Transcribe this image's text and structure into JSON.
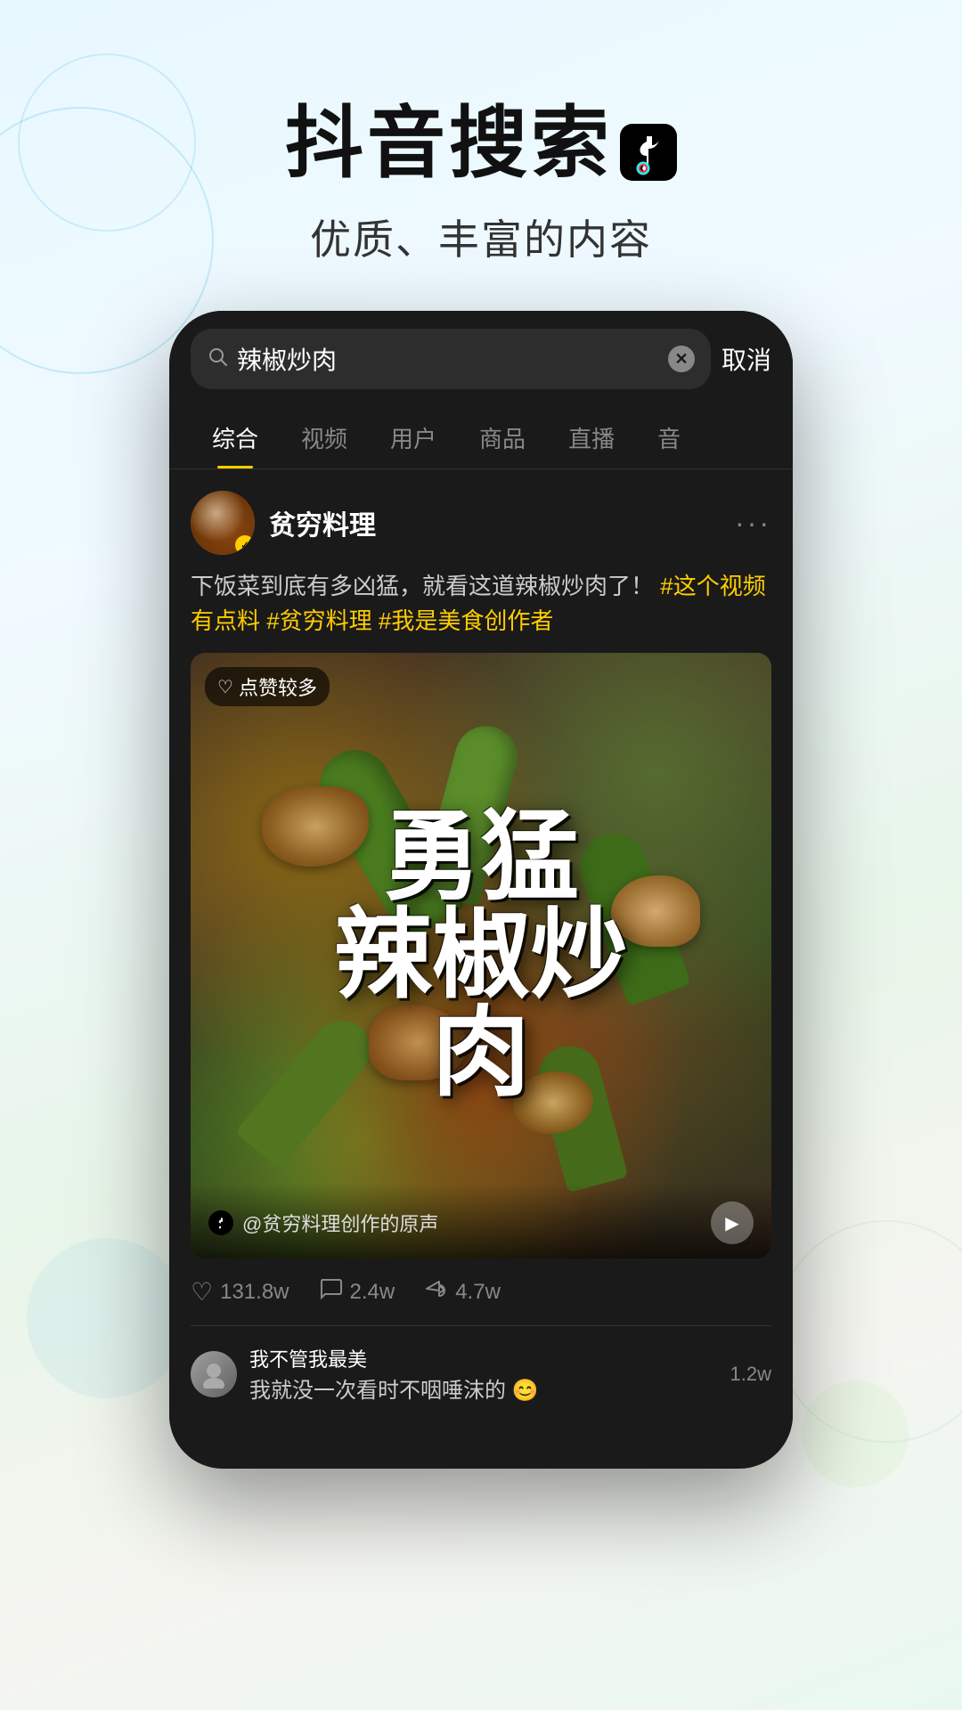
{
  "background": {
    "gradient_start": "#e8f8ff",
    "gradient_end": "#e8f8f0"
  },
  "header": {
    "title": "抖音搜索",
    "subtitle": "优质、丰富的内容",
    "logo_alt": "TikTok logo"
  },
  "phone": {
    "search_bar": {
      "query": "辣椒炒肉",
      "placeholder": "辣椒炒肉",
      "cancel_label": "取消"
    },
    "tabs": [
      {
        "label": "综合",
        "active": true
      },
      {
        "label": "视频",
        "active": false
      },
      {
        "label": "用户",
        "active": false
      },
      {
        "label": "商品",
        "active": false
      },
      {
        "label": "直播",
        "active": false
      },
      {
        "label": "音",
        "active": false
      }
    ],
    "post": {
      "username": "贫穷料理",
      "verified": true,
      "description": "下饭菜到底有多凶猛，就看这道辣椒炒肉了！",
      "hashtags": [
        "#这个视频有点料",
        "#贫穷料理",
        "#我是美食创作者"
      ],
      "badge_text": "点赞较多",
      "video_title": "勇猛辣椒炒肉",
      "calligraphy_lines": [
        "勇猛",
        "辣椒炒",
        "肉"
      ],
      "video_source": "@贫穷料理创作的原声",
      "stats": {
        "likes": "131.8w",
        "comments": "2.4w",
        "shares": "4.7w"
      },
      "comment_preview": {
        "username": "我不管我最美",
        "text": "我就没一次看时不咽唾沫的 😊",
        "count": "1.2w"
      }
    }
  }
}
